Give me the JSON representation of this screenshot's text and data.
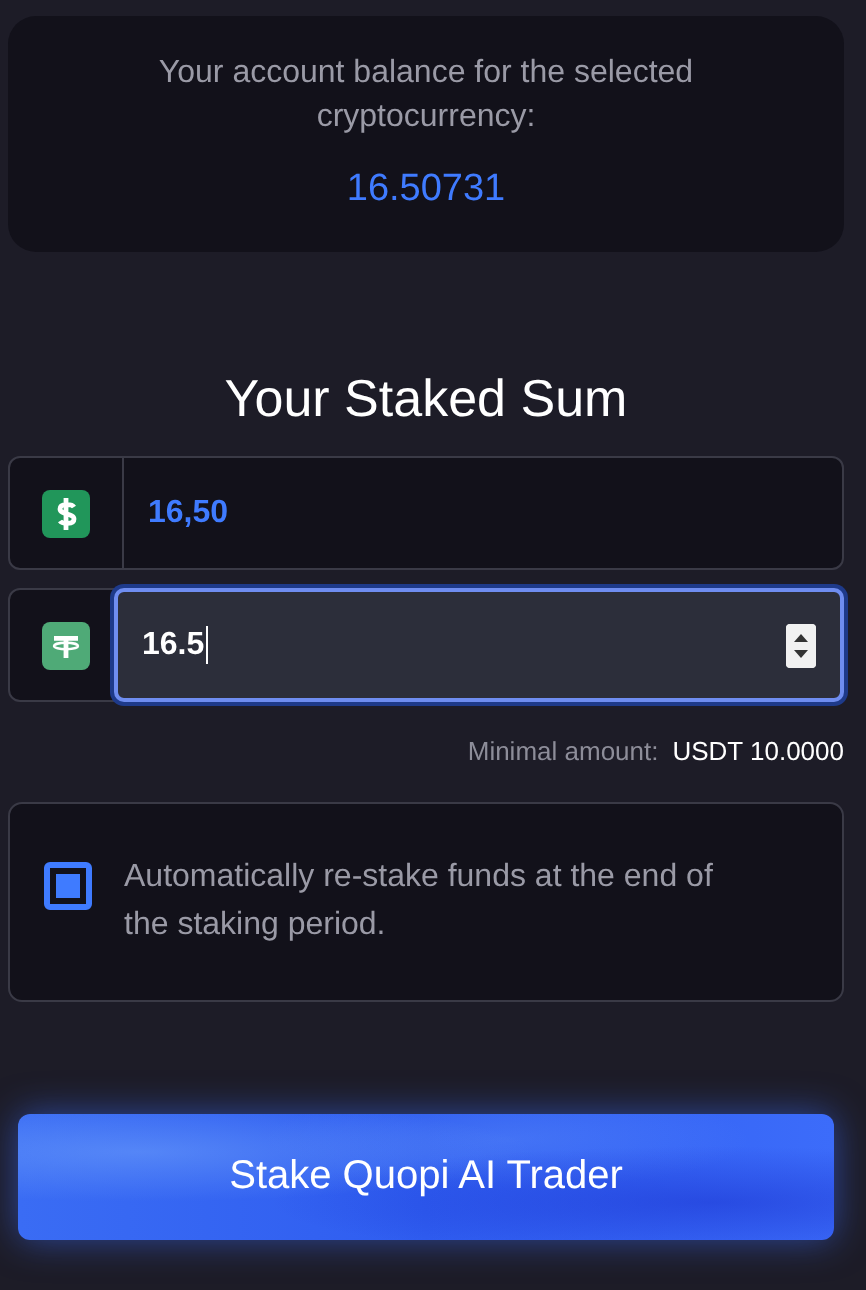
{
  "balance": {
    "label": "Your account balance for the selected cryptocurrency:",
    "value": "16.50731"
  },
  "title": "Your Staked Sum",
  "amounts": [
    {
      "kind": "usd",
      "focused": false,
      "value": "16,50"
    },
    {
      "kind": "usdt",
      "focused": true,
      "value": "16.5"
    }
  ],
  "minimum": {
    "label": "Minimal amount:",
    "value": "USDT 10.0000"
  },
  "auto_restake": {
    "checked": true,
    "label": "Automatically re-stake funds at the end of the staking period."
  },
  "stake_button": {
    "label": "Stake Quopi AI Trader"
  }
}
